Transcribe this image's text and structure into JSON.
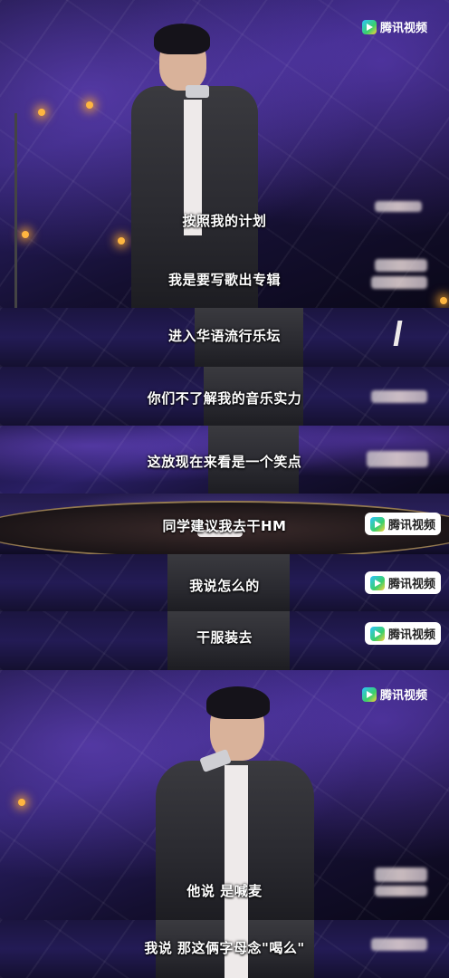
{
  "watermark": {
    "brand": "腾讯视频"
  },
  "subtitles": [
    "按照我的计划",
    "我是要写歌出专辑",
    "进入华语流行乐坛",
    "你们不了解我的音乐实力",
    "这放现在来看是一个笑点",
    "同学建议我去干HM",
    "我说怎么的",
    "干服装去",
    "他说 是喊麦",
    "我说 那这俩字母念\"喝么\""
  ],
  "colors": {
    "stage_purple": "#2a1f66",
    "subtitle_text": "#ffffff",
    "stage_light": "#ffb640"
  }
}
